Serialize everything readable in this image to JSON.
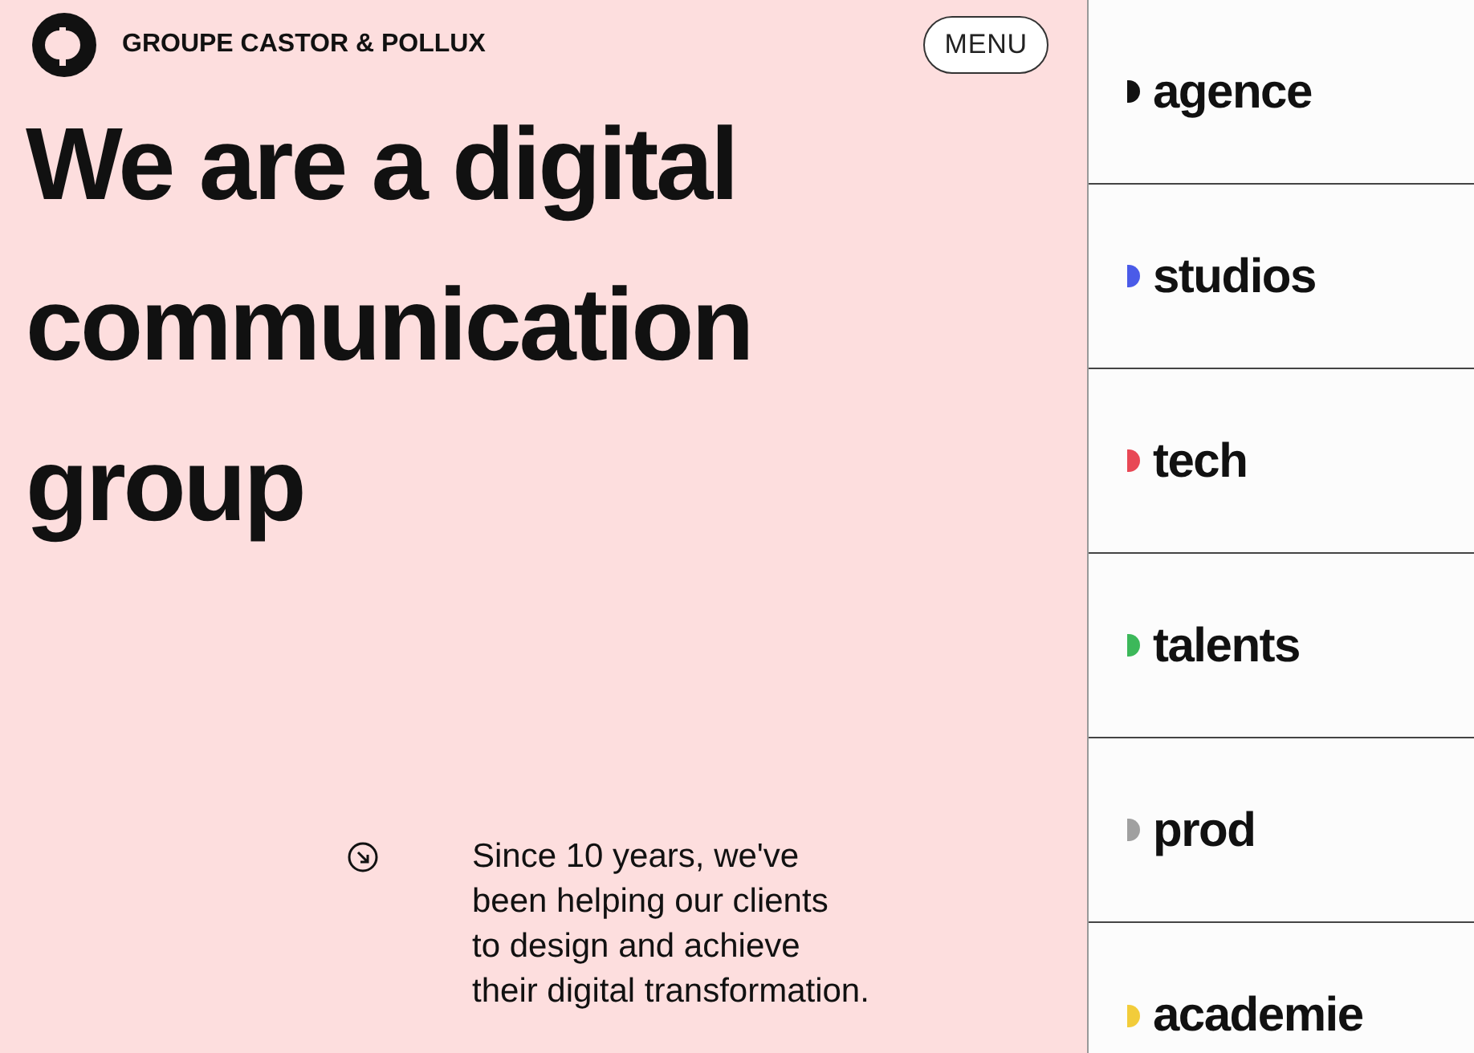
{
  "brand": {
    "name": "GROUPE CASTOR & POLLUX"
  },
  "menu_button": "MENU",
  "headline": "We are a digital communication group",
  "intro": {
    "lines": [
      "Since 10 years, we've",
      "been helping our clients",
      "to design and achieve",
      "their digital transformation."
    ]
  },
  "divisions": [
    {
      "label": "agence",
      "color": "#111111"
    },
    {
      "label": "studios",
      "color": "#4a5be8"
    },
    {
      "label": "tech",
      "color": "#e84855"
    },
    {
      "label": "talents",
      "color": "#3cb85a"
    },
    {
      "label": "prod",
      "color": "#a0a0a0"
    },
    {
      "label": "academie",
      "color": "#f2cc3a"
    }
  ]
}
